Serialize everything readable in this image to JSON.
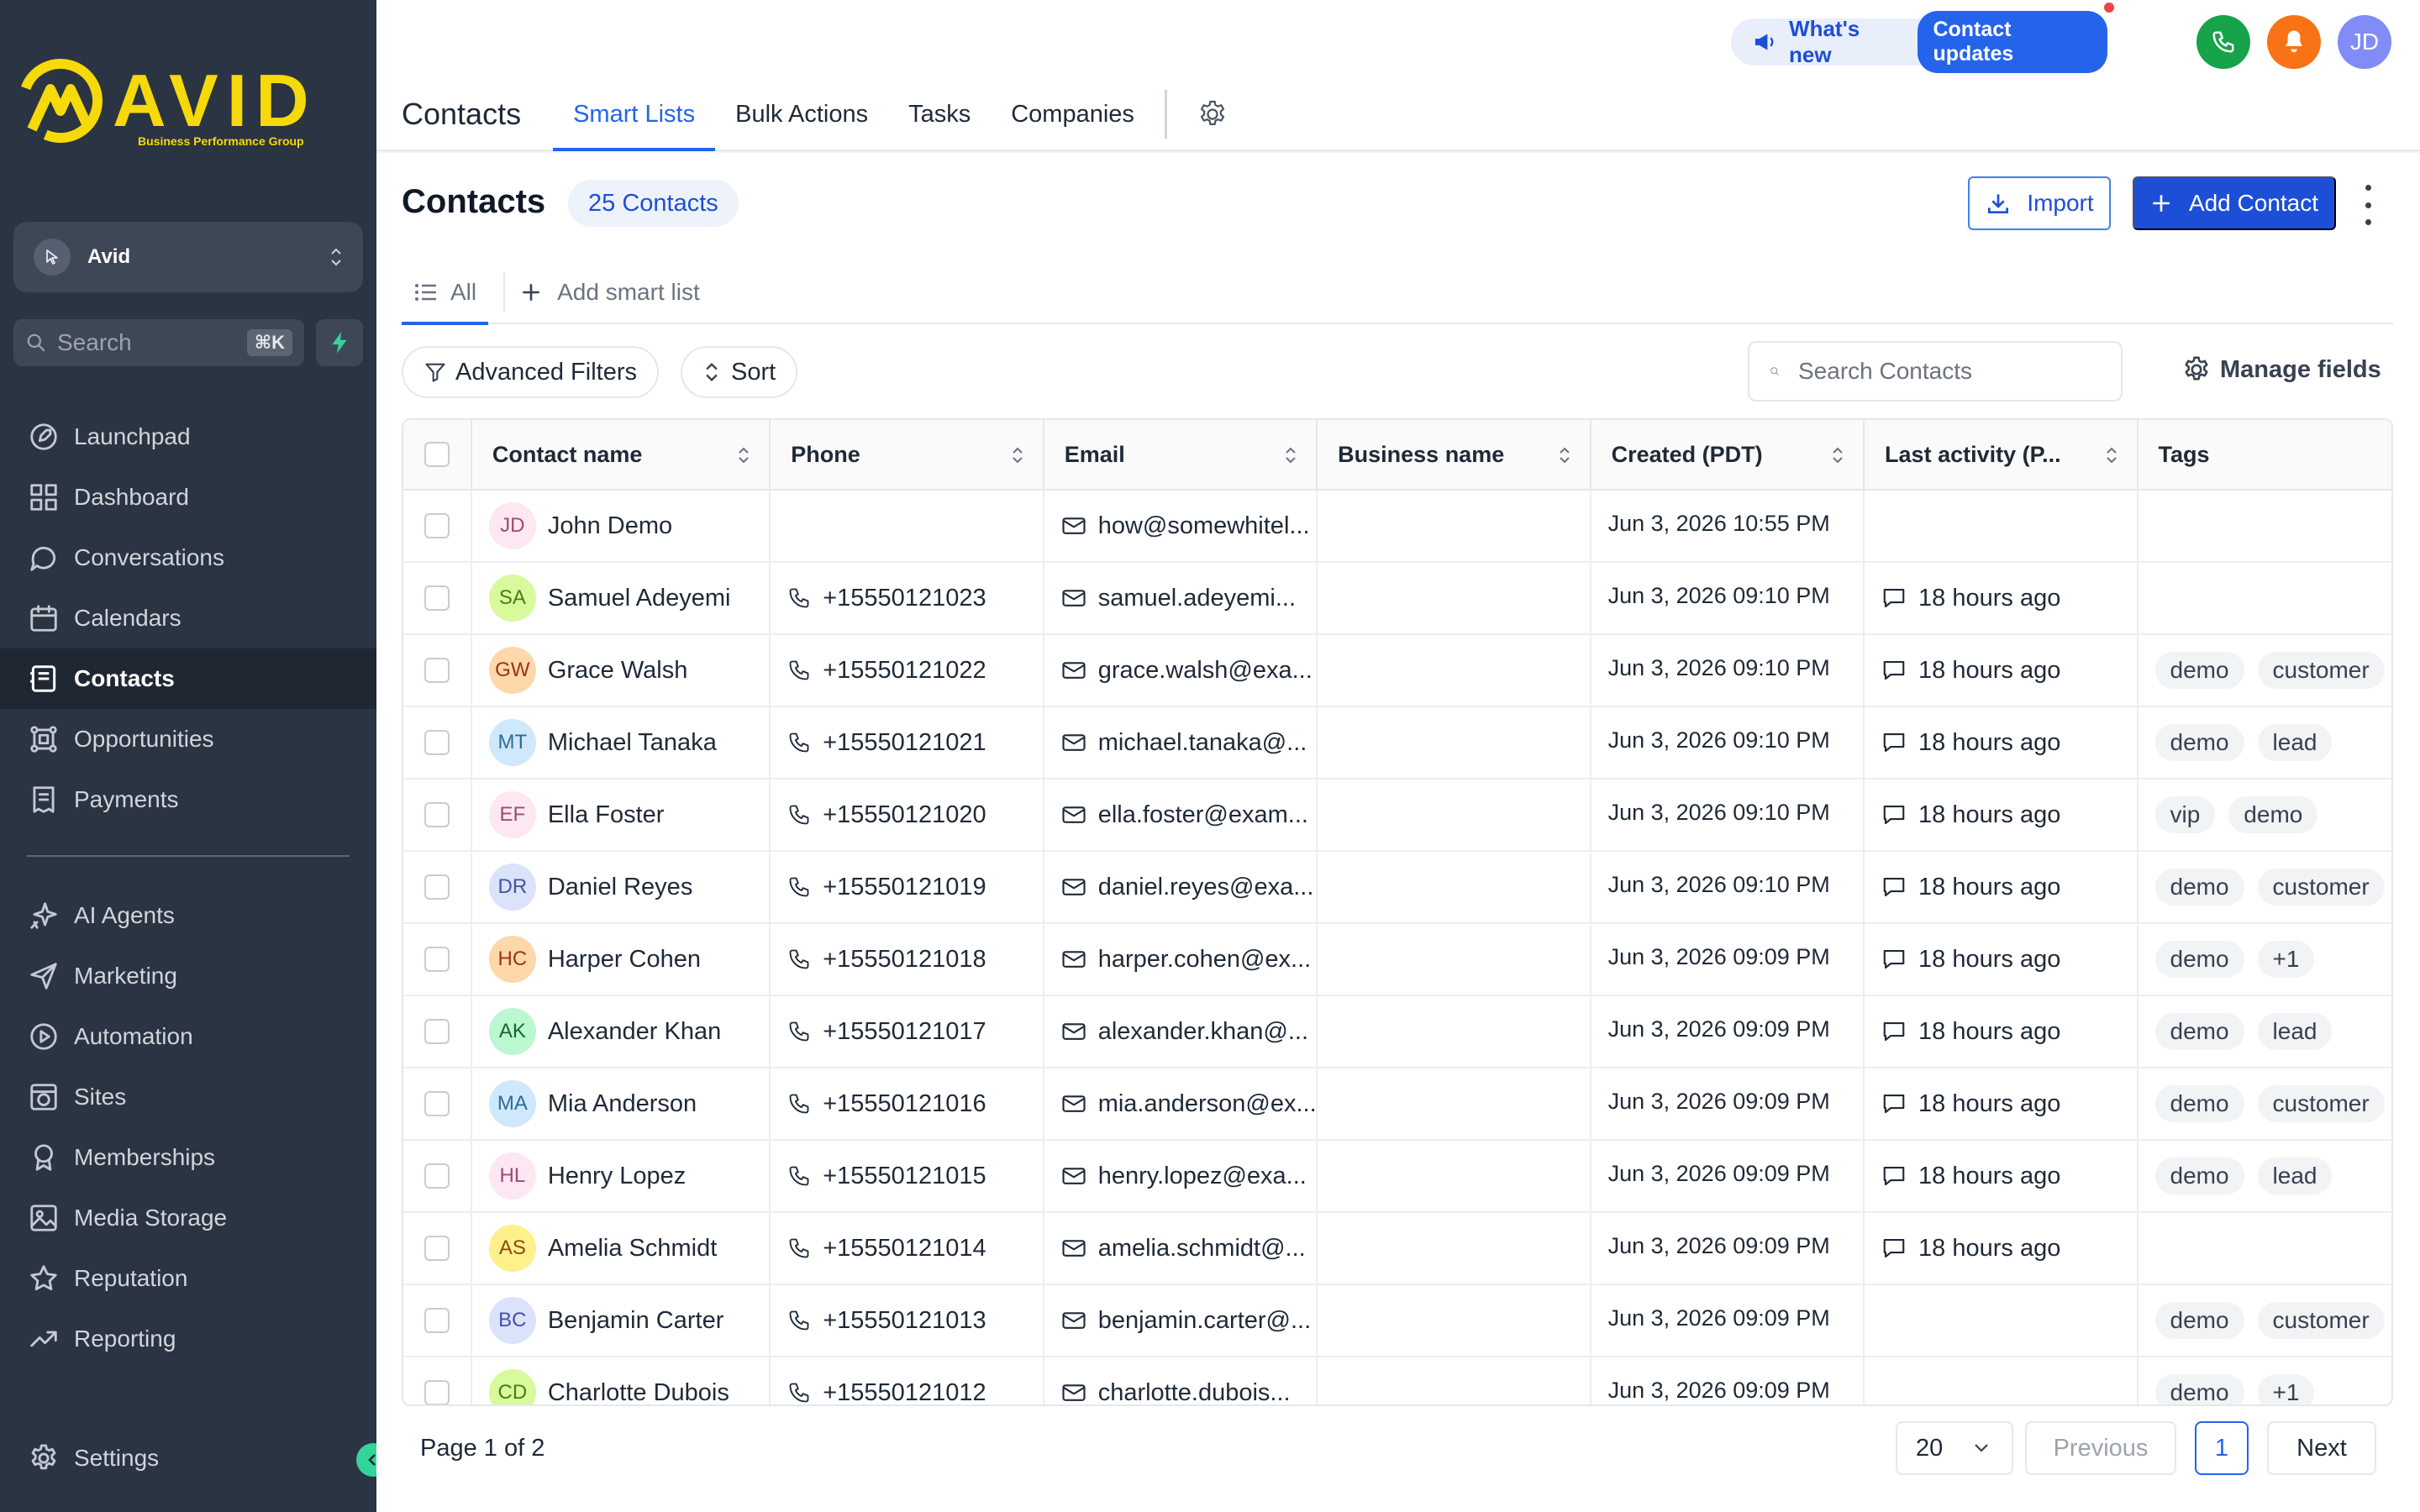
{
  "brand": {
    "logo_text": "AVID",
    "logo_sub": "Business Performance Group",
    "accent": "#f5d90a"
  },
  "account": {
    "name": "Avid"
  },
  "sidebar_search": {
    "placeholder": "Search",
    "shortcut": "⌘K"
  },
  "nav": [
    {
      "id": "launchpad",
      "label": "Launchpad",
      "icon": "rocket-icon"
    },
    {
      "id": "dashboard",
      "label": "Dashboard",
      "icon": "grid-icon"
    },
    {
      "id": "conversations",
      "label": "Conversations",
      "icon": "chat-icon"
    },
    {
      "id": "calendars",
      "label": "Calendars",
      "icon": "calendar-icon"
    },
    {
      "id": "contacts",
      "label": "Contacts",
      "icon": "contacts-icon",
      "active": true
    },
    {
      "id": "opportunities",
      "label": "Opportunities",
      "icon": "network-icon"
    },
    {
      "id": "payments",
      "label": "Payments",
      "icon": "receipt-icon"
    },
    {
      "id": "ai-agents",
      "label": "AI Agents",
      "icon": "sparkle-icon"
    },
    {
      "id": "marketing",
      "label": "Marketing",
      "icon": "send-icon"
    },
    {
      "id": "automation",
      "label": "Automation",
      "icon": "automation-icon"
    },
    {
      "id": "sites",
      "label": "Sites",
      "icon": "globe-window-icon"
    },
    {
      "id": "memberships",
      "label": "Memberships",
      "icon": "badge-icon"
    },
    {
      "id": "media-storage",
      "label": "Media Storage",
      "icon": "image-icon"
    },
    {
      "id": "reputation",
      "label": "Reputation",
      "icon": "star-icon"
    },
    {
      "id": "reporting",
      "label": "Reporting",
      "icon": "trend-icon"
    },
    {
      "id": "settings",
      "label": "Settings",
      "icon": "gear-icon"
    }
  ],
  "header": {
    "tabs": [
      "Contacts",
      "Smart Lists",
      "Bulk Actions",
      "Tasks",
      "Companies"
    ],
    "active_tab": "Smart Lists",
    "whats_new": "What's new",
    "updates_pill": "Contact updates",
    "user_initials": "JD",
    "colors": {
      "phone": "#16a34a",
      "bell": "#f97316",
      "avatar": "#818cf8"
    }
  },
  "page": {
    "title": "Contacts",
    "count_badge": "25 Contacts",
    "import_label": "Import",
    "add_label": "Add Contact",
    "smart_all": "All",
    "add_smart_list": "Add smart list",
    "advanced_filters": "Advanced Filters",
    "sort": "Sort",
    "search_placeholder": "Search Contacts",
    "manage_fields": "Manage fields"
  },
  "table": {
    "columns": [
      "Contact name",
      "Phone",
      "Email",
      "Business name",
      "Created (PDT)",
      "Last activity (P...",
      "Tags"
    ],
    "rows": [
      {
        "initials": "JD",
        "avatar_bg": "#fce7f3",
        "avatar_fg": "#9d4b73",
        "name": "John Demo",
        "phone": "",
        "email": "how@somewhitel...",
        "business": "",
        "created": "Jun 3, 2026 10:55 PM",
        "activity": "",
        "tags": []
      },
      {
        "initials": "SA",
        "avatar_bg": "#d9f99d",
        "avatar_fg": "#4d7c0f",
        "name": "Samuel Adeyemi",
        "phone": "+15550121023",
        "email": "samuel.adeyemi...",
        "business": "",
        "created": "Jun 3, 2026 09:10 PM",
        "activity": "18 hours ago",
        "tags": []
      },
      {
        "initials": "GW",
        "avatar_bg": "#fed7aa",
        "avatar_fg": "#9a3412",
        "name": "Grace Walsh",
        "phone": "+15550121022",
        "email": "grace.walsh@exa...",
        "business": "",
        "created": "Jun 3, 2026 09:10 PM",
        "activity": "18 hours ago",
        "tags": [
          "demo",
          "customer"
        ]
      },
      {
        "initials": "MT",
        "avatar_bg": "#cfe8fb",
        "avatar_fg": "#2f6a99",
        "name": "Michael Tanaka",
        "phone": "+15550121021",
        "email": "michael.tanaka@...",
        "business": "",
        "created": "Jun 3, 2026 09:10 PM",
        "activity": "18 hours ago",
        "tags": [
          "demo",
          "lead"
        ]
      },
      {
        "initials": "EF",
        "avatar_bg": "#fce7f3",
        "avatar_fg": "#9d4b73",
        "name": "Ella Foster",
        "phone": "+15550121020",
        "email": "ella.foster@exam...",
        "business": "",
        "created": "Jun 3, 2026 09:10 PM",
        "activity": "18 hours ago",
        "tags": [
          "vip",
          "demo"
        ]
      },
      {
        "initials": "DR",
        "avatar_bg": "#dbe3fb",
        "avatar_fg": "#4451a3",
        "name": "Daniel Reyes",
        "phone": "+15550121019",
        "email": "daniel.reyes@exa...",
        "business": "",
        "created": "Jun 3, 2026 09:10 PM",
        "activity": "18 hours ago",
        "tags": [
          "demo",
          "customer"
        ]
      },
      {
        "initials": "HC",
        "avatar_bg": "#fed7aa",
        "avatar_fg": "#9a3412",
        "name": "Harper Cohen",
        "phone": "+15550121018",
        "email": "harper.cohen@ex...",
        "business": "",
        "created": "Jun 3, 2026 09:09 PM",
        "activity": "18 hours ago",
        "tags": [
          "demo",
          "+1"
        ]
      },
      {
        "initials": "AK",
        "avatar_bg": "#bbf7d0",
        "avatar_fg": "#166534",
        "name": "Alexander Khan",
        "phone": "+15550121017",
        "email": "alexander.khan@...",
        "business": "",
        "created": "Jun 3, 2026 09:09 PM",
        "activity": "18 hours ago",
        "tags": [
          "demo",
          "lead"
        ]
      },
      {
        "initials": "MA",
        "avatar_bg": "#cfe8fb",
        "avatar_fg": "#2f6a99",
        "name": "Mia Anderson",
        "phone": "+15550121016",
        "email": "mia.anderson@ex...",
        "business": "",
        "created": "Jun 3, 2026 09:09 PM",
        "activity": "18 hours ago",
        "tags": [
          "demo",
          "customer"
        ]
      },
      {
        "initials": "HL",
        "avatar_bg": "#fce7f3",
        "avatar_fg": "#9d4b73",
        "name": "Henry Lopez",
        "phone": "+15550121015",
        "email": "henry.lopez@exa...",
        "business": "",
        "created": "Jun 3, 2026 09:09 PM",
        "activity": "18 hours ago",
        "tags": [
          "demo",
          "lead"
        ]
      },
      {
        "initials": "AS",
        "avatar_bg": "#fef08a",
        "avatar_fg": "#854d0e",
        "name": "Amelia Schmidt",
        "phone": "+15550121014",
        "email": "amelia.schmidt@...",
        "business": "",
        "created": "Jun 3, 2026 09:09 PM",
        "activity": "18 hours ago",
        "tags": []
      },
      {
        "initials": "BC",
        "avatar_bg": "#dbe3fb",
        "avatar_fg": "#4451a3",
        "name": "Benjamin Carter",
        "phone": "+15550121013",
        "email": "benjamin.carter@...",
        "business": "",
        "created": "Jun 3, 2026 09:09 PM",
        "activity": "",
        "tags": [
          "demo",
          "customer"
        ]
      },
      {
        "initials": "CD",
        "avatar_bg": "#d9f99d",
        "avatar_fg": "#4d7c0f",
        "name": "Charlotte Dubois",
        "phone": "+15550121012",
        "email": "charlotte.dubois...",
        "business": "",
        "created": "Jun 3, 2026 09:09 PM",
        "activity": "",
        "tags": [
          "demo",
          "+1"
        ]
      }
    ]
  },
  "pagination": {
    "info": "Page 1 of 2",
    "page_size": "20",
    "prev": "Previous",
    "current": "1",
    "next": "Next"
  }
}
